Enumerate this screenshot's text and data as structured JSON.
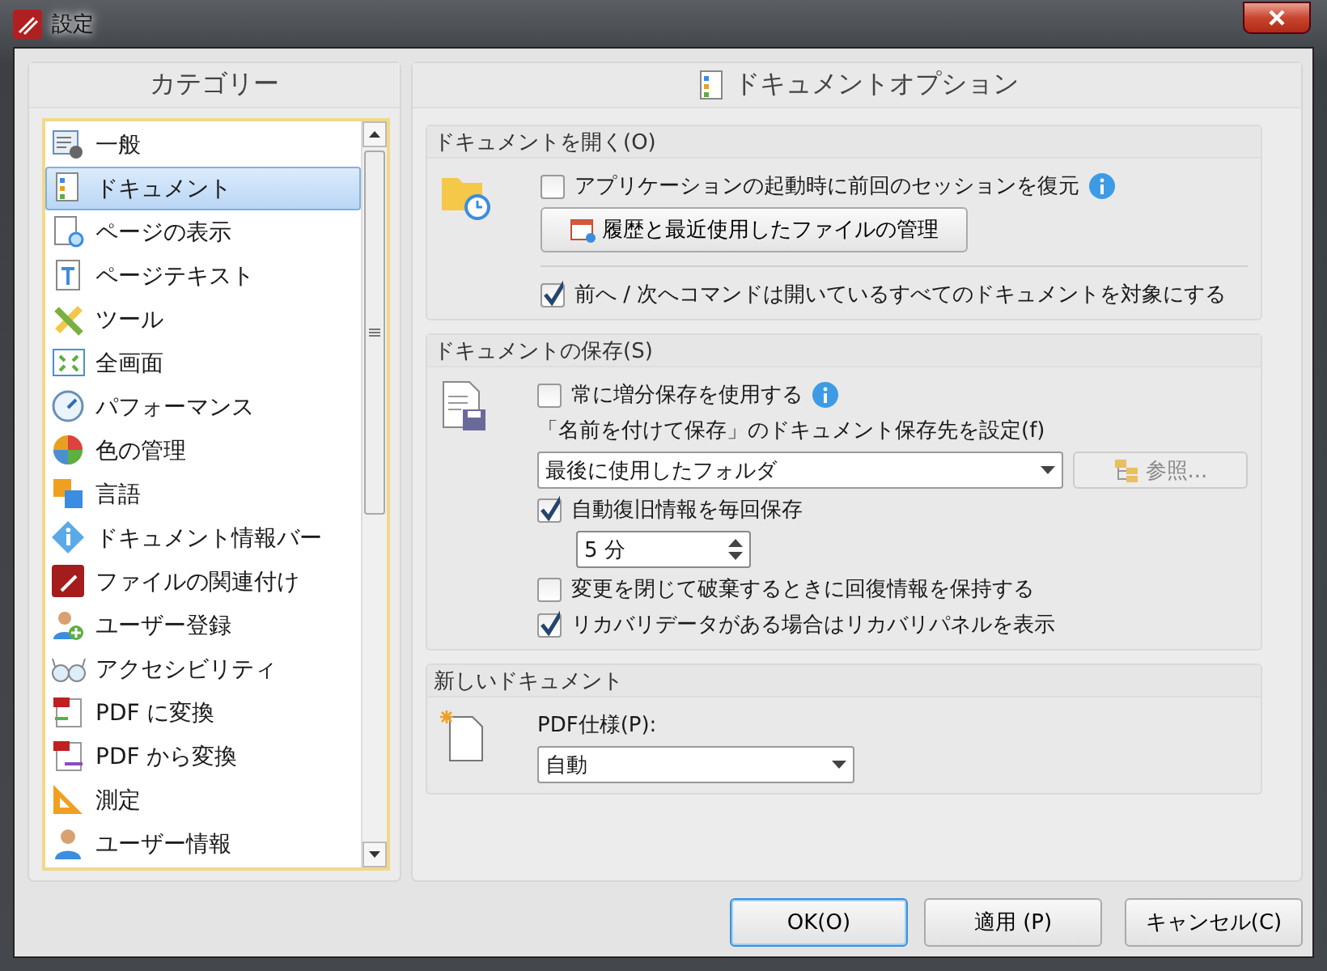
{
  "window": {
    "title": "設定"
  },
  "categories": {
    "title": "カテゴリー",
    "items": [
      {
        "label": "一般",
        "selected": false
      },
      {
        "label": "ドキュメント",
        "selected": true
      },
      {
        "label": "ページの表示",
        "selected": false
      },
      {
        "label": "ページテキスト",
        "selected": false
      },
      {
        "label": "ツール",
        "selected": false
      },
      {
        "label": "全画面",
        "selected": false
      },
      {
        "label": "パフォーマンス",
        "selected": false
      },
      {
        "label": "色の管理",
        "selected": false
      },
      {
        "label": "言語",
        "selected": false
      },
      {
        "label": "ドキュメント情報バー",
        "selected": false
      },
      {
        "label": "ファイルの関連付け",
        "selected": false
      },
      {
        "label": "ユーザー登録",
        "selected": false
      },
      {
        "label": "アクセシビリティ",
        "selected": false
      },
      {
        "label": "PDF に変換",
        "selected": false
      },
      {
        "label": "PDF から変換",
        "selected": false
      },
      {
        "label": "測定",
        "selected": false
      },
      {
        "label": "ユーザー情報",
        "selected": false
      }
    ]
  },
  "options": {
    "title": "ドキュメントオプション",
    "sections": [
      {
        "title": "ドキュメントを開く(O)",
        "rows": [
          {
            "kind": "checkbox",
            "label": "アプリケーションの起動時に前回のセッションを復元",
            "checked": false,
            "info": true
          },
          {
            "kind": "button",
            "label": "履歴と最近使用したファイルの管理"
          },
          {
            "kind": "divider"
          },
          {
            "kind": "checkbox",
            "label": "前へ / 次へコマンドは開いているすべてのドキュメントを対象にする",
            "checked": true,
            "info": false
          }
        ]
      },
      {
        "title": "ドキュメントの保存(S)",
        "rows": [
          {
            "kind": "checkbox",
            "label": "常に増分保存を使用する",
            "checked": false,
            "info": true
          },
          {
            "kind": "label",
            "label": "「名前を付けて保存」のドキュメント保存先を設定(f)"
          },
          {
            "kind": "dropdown",
            "value": "最後に使用したフォルダ",
            "button": {
              "label": "参照...",
              "disabled": true
            }
          },
          {
            "kind": "checkbox",
            "label": "自動復旧情報を毎回保存",
            "checked": true,
            "info": false
          },
          {
            "kind": "spinner",
            "value": "5 分"
          },
          {
            "kind": "checkbox",
            "label": "変更を閉じて破棄するときに回復情報を保持する",
            "checked": false,
            "info": false
          },
          {
            "kind": "checkbox",
            "label": "リカバリデータがある場合はリカバリパネルを表示",
            "checked": true,
            "info": false
          }
        ]
      },
      {
        "title": "新しいドキュメント",
        "rows": [
          {
            "kind": "label",
            "label": "PDF仕様(P):"
          },
          {
            "kind": "dropdown",
            "value": "自動"
          }
        ]
      }
    ]
  },
  "buttons": [
    {
      "label": "OK(O)",
      "default": true
    },
    {
      "label": "適用 (P)",
      "default": false
    },
    {
      "label": "キャンセル(C)",
      "default": false
    }
  ]
}
